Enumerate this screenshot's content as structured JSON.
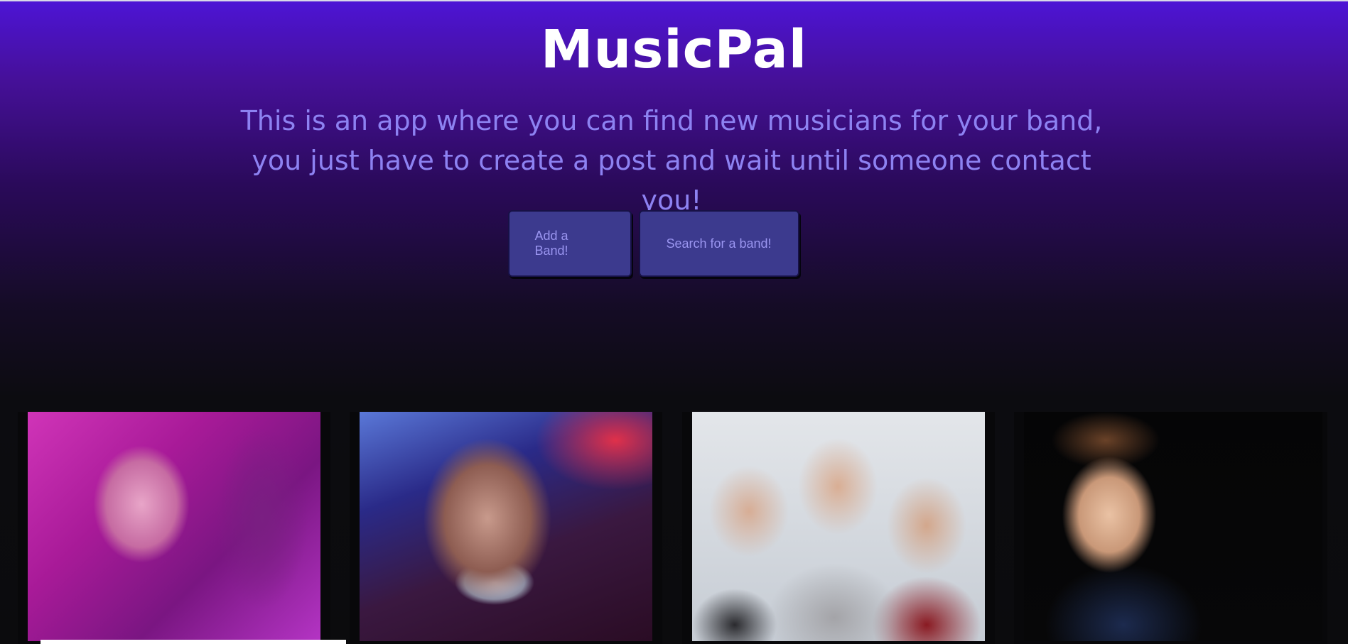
{
  "app": {
    "title": "MusicPal",
    "tagline": "This is an app where you can find new musicians for your band, you just have to create a post and wait until someone contact you!"
  },
  "actions": {
    "add_band_label": "Add a Band!",
    "search_band_label": "Search for a band!"
  },
  "colors": {
    "header_top": "#4d14d6",
    "background_bottom": "#0b0b0d",
    "title": "#ffffff",
    "tagline": "#8d82f2",
    "button_bg": "#3c3a8e",
    "button_text": "#9a95f0"
  },
  "gallery": {
    "cards": [
      {
        "image": "artist-photo-1"
      },
      {
        "image": "artist-photo-2"
      },
      {
        "image": "band-photo-3"
      },
      {
        "image": "artist-photo-4"
      }
    ]
  }
}
